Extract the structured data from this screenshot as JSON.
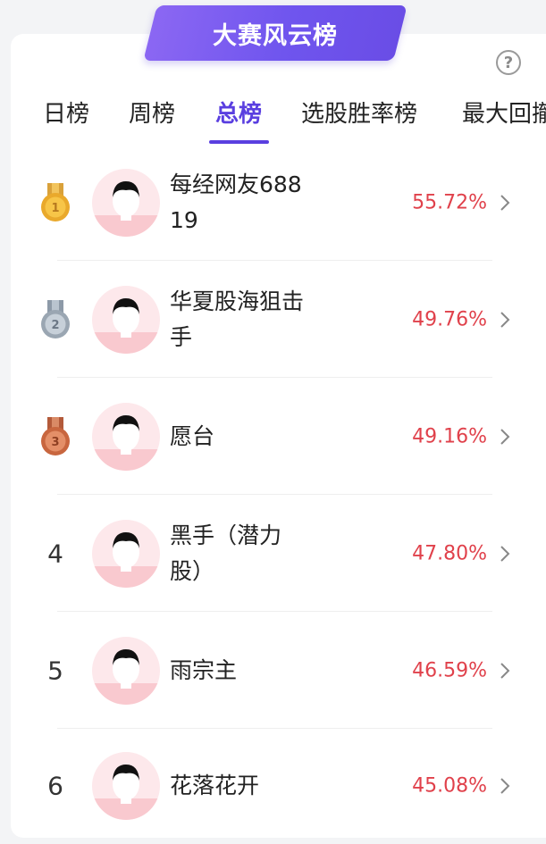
{
  "header": {
    "title": "大赛风云榜",
    "help_symbol": "?"
  },
  "tabs": [
    {
      "label": "日榜",
      "active": false
    },
    {
      "label": "周榜",
      "active": false
    },
    {
      "label": "总榜",
      "active": true
    },
    {
      "label": "选股胜率榜",
      "active": false
    },
    {
      "label": "最大回撤",
      "active": false
    }
  ],
  "ranking": [
    {
      "rank": "1",
      "medal": "gold-medal-icon",
      "name": "每经网友68819",
      "rate": "55.72%"
    },
    {
      "rank": "2",
      "medal": "silver-medal-icon",
      "name": "华夏股海狙击手",
      "rate": "49.76%"
    },
    {
      "rank": "3",
      "medal": "bronze-medal-icon",
      "name": "愿台",
      "rate": "49.16%"
    },
    {
      "rank": "4",
      "name": "黑手（潜力股）",
      "rate": "47.80%"
    },
    {
      "rank": "5",
      "name": "雨宗主",
      "rate": "46.59%"
    },
    {
      "rank": "6",
      "name": "花落花开",
      "rate": "45.08%"
    }
  ],
  "colors": {
    "accent": "#5a3fe0",
    "rate": "#e0414b",
    "avatar_bg": "#fde8eb"
  }
}
